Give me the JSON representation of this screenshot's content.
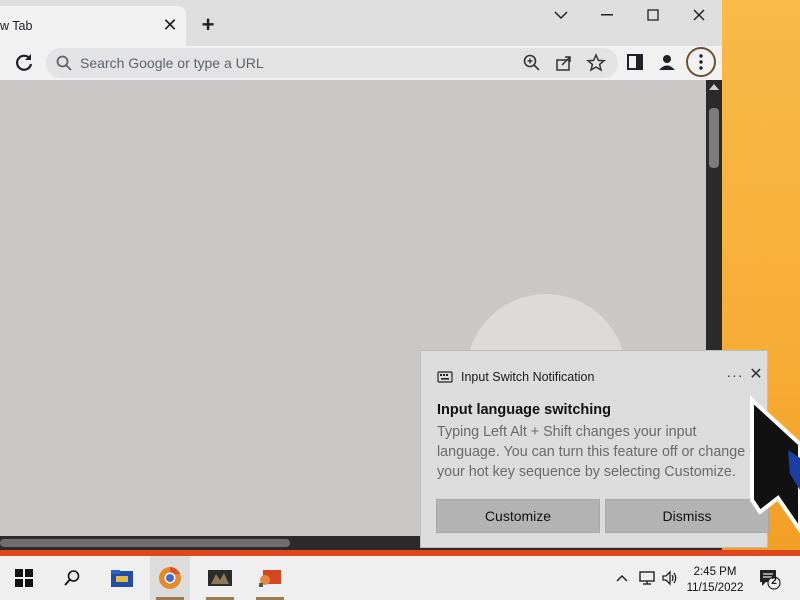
{
  "browser": {
    "tab_title": "w Tab",
    "tab_close_glyph": "✕",
    "new_tab_glyph": "+",
    "omnibox_placeholder": "Search Google or type a URL",
    "window_controls": {
      "minimize": "chevron-down",
      "maximize": "square",
      "close": "✕"
    }
  },
  "notification": {
    "app_name": "Input Switch Notification",
    "more_glyph": "···",
    "close_glyph": "✕",
    "heading": "Input language switching",
    "body": "Typing Left Alt + Shift changes your input language. You can turn this feature off or change your hot key sequence by selecting Customize.",
    "buttons": {
      "customize": "Customize",
      "dismiss": "Dismiss"
    }
  },
  "taskbar": {
    "time": "2:45 PM",
    "date": "11/15/2022",
    "notification_count": "2",
    "apps": [
      "start",
      "search",
      "file-explorer",
      "chrome",
      "app-1",
      "app-2"
    ]
  },
  "colors": {
    "desktop_accent": "#f8b540",
    "taskbar_bg": "#efefef",
    "toast_bg": "#dcdcdc",
    "toast_button_bg": "#b3b3b3",
    "red_strip": "#e0461d"
  }
}
